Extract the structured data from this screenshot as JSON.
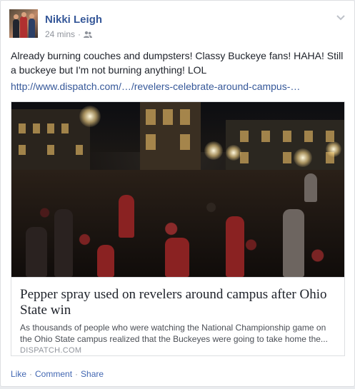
{
  "post": {
    "author": "Nikki Leigh",
    "time": "24 mins",
    "time_separator": "·",
    "audience_icon": "friends-icon",
    "menu_icon": "chevron-down-icon",
    "text": "Already burning couches and dumpsters! Classy Buckeye fans! HAHA! Still a buckeye but I'm not burning anything! LOL",
    "link_text": "http://www.dispatch.com/…/revelers-celebrate-around-campus-…"
  },
  "preview": {
    "headline": "Pepper spray used on revelers around campus after Ohio State win",
    "description": "As thousands of people who were watching the National Championship game on the Ohio State campus realized that the Buckeyes were going to take home the...",
    "domain": "DISPATCH.COM"
  },
  "actions": {
    "like": "Like",
    "comment": "Comment",
    "share": "Share",
    "separator": "·"
  },
  "colors": {
    "link_blue": "#365899",
    "action_blue": "#4267b2",
    "meta_grey": "#90949c"
  }
}
